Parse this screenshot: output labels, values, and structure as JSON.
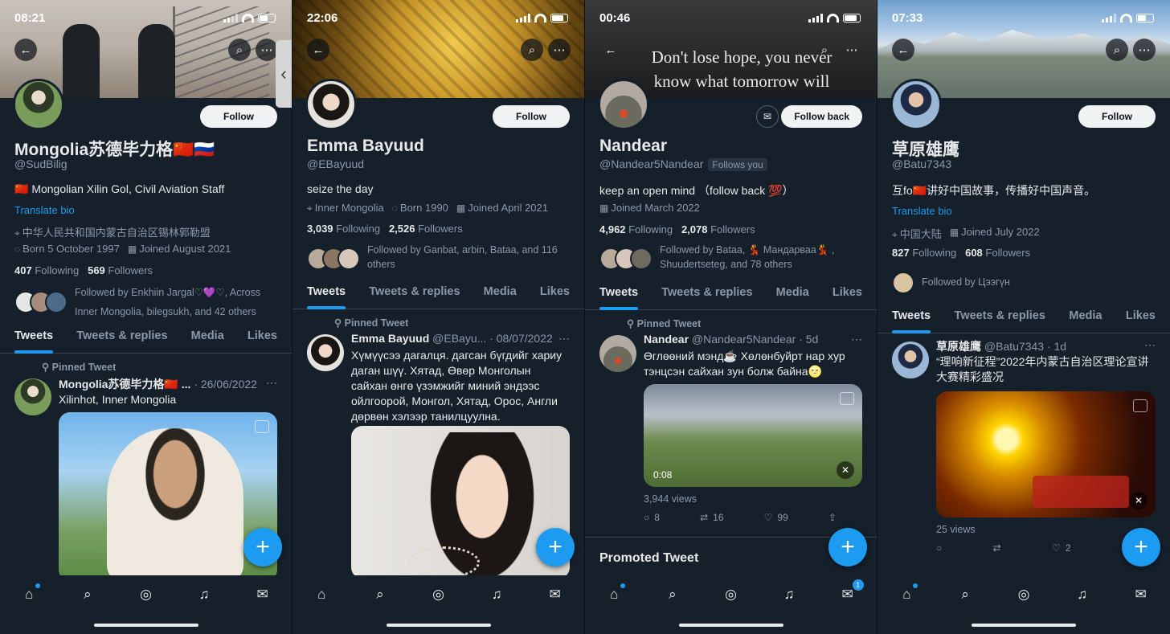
{
  "phones": [
    {
      "time": "08:21",
      "name": "Mongolia苏德毕力格🇨🇳🇷🇺",
      "handle": "@SudBilig",
      "follow_label": "Follow",
      "bio": "🇨🇳 Mongolian Xilin Gol, Civil Aviation Staff",
      "translate": "Translate bio",
      "location": "中华人民共和国内蒙古自治区锡林郭勒盟",
      "born": "Born 5 October 1997",
      "joined": "Joined August 2021",
      "following": "407",
      "followers": "569",
      "following_label": "Following",
      "followers_label": "Followers",
      "followed_by": "Followed by Enkhiin Jargal♡💜♡, Across Inner Mongolia, bilegsukh, and 42 others",
      "tabs": [
        "Tweets",
        "Tweets & replies",
        "Media",
        "Likes"
      ],
      "pinned": "Pinned Tweet",
      "tweet_name": "Mongolia苏德毕力格🇨🇳 ...",
      "tweet_meta": "· 26/06/2022",
      "tweet_text": "Xilinhot, Inner Mongolia"
    },
    {
      "time": "22:06",
      "name": "Emma Bayuud",
      "handle": "@EBayuud",
      "follow_label": "Follow",
      "bio": "seize the day",
      "location": "Inner Mongolia",
      "born": "Born 1990",
      "joined": "Joined April 2021",
      "following": "3,039",
      "followers": "2,526",
      "following_label": "Following",
      "followers_label": "Followers",
      "followed_by": "Followed by Ganbat, arbin, Bataa, and 116 others",
      "tabs": [
        "Tweets",
        "Tweets & replies",
        "Media",
        "Likes"
      ],
      "pinned": "Pinned Tweet",
      "tweet_name": "Emma Bayuud",
      "tweet_meta": "@EBayu... · 08/07/2022",
      "tweet_text": "Хүмүүсээ дагалця. дагсан бүгдийг хариу даган шүү. Хятад,  Өвөр Монголын сайхан өнгө үзэмжийг миний эндээс ойлгоорой, Монгол,  Хятад,  Орос, Англи дөрвөн хэлээр танилцуулна."
    },
    {
      "time": "00:46",
      "banner_quote": "Don't lose hope, you never know what tomorrow will bring.",
      "name": "Nandear",
      "handle": "@Nandear5Nandear",
      "follows_you": "Follows you",
      "follow_label": "Follow back",
      "bio": "keep an open mind  （follow back 💯）",
      "joined": "Joined March 2022",
      "following": "4,962",
      "followers": "2,078",
      "following_label": "Following",
      "followers_label": "Followers",
      "followed_by": "Followed by Bataa, 💃 Мандарваа💃 , Shuudertseteg, and 78 others",
      "tabs": [
        "Tweets",
        "Tweets & replies",
        "Media",
        "Likes"
      ],
      "pinned": "Pinned Tweet",
      "tweet_name": "Nandear",
      "tweet_meta": "@Nandear5Nandear · 5d",
      "tweet_text": "Өглөөний мэнд☕ Хөлөнбуйрт нар хур тэнцсэн сайхан зун болж байна🌝",
      "video_time": "0:08",
      "views": "3,944 views",
      "replies": "8",
      "retweets": "16",
      "likes": "99",
      "promoted": "Promoted Tweet",
      "mail_badge": "1"
    },
    {
      "time": "07:33",
      "name": "草原雄鹰",
      "handle": "@Batu7343",
      "follow_label": "Follow",
      "bio": "互fo🇨🇳讲好中国故事，传播好中国声音。",
      "translate": "Translate bio",
      "location": "中国大陆",
      "joined": "Joined July 2022",
      "following": "827",
      "followers": "608",
      "following_label": "Following",
      "followers_label": "Followers",
      "followed_by": "Followed by Цээгүн",
      "tabs": [
        "Tweets",
        "Tweets & replies",
        "Media",
        "Likes"
      ],
      "tweet_name": "草原雄鹰",
      "tweet_meta": "@Batu7343 · 1d",
      "tweet_text": "“理响新征程”2022年内蒙古自治区理论宣讲大赛精彩盛况",
      "views": "25 views",
      "likes": "2"
    }
  ],
  "icons": {
    "back": "back-arrow-icon",
    "search": "search-icon",
    "more": "more-icon",
    "location": "location-pin-icon",
    "birthday": "balloon-icon",
    "calendar": "calendar-icon",
    "pin": "pin-icon"
  },
  "colors": {
    "background": "#15202b",
    "accent": "#1d9bf0",
    "secondary_text": "#8b98a5"
  }
}
